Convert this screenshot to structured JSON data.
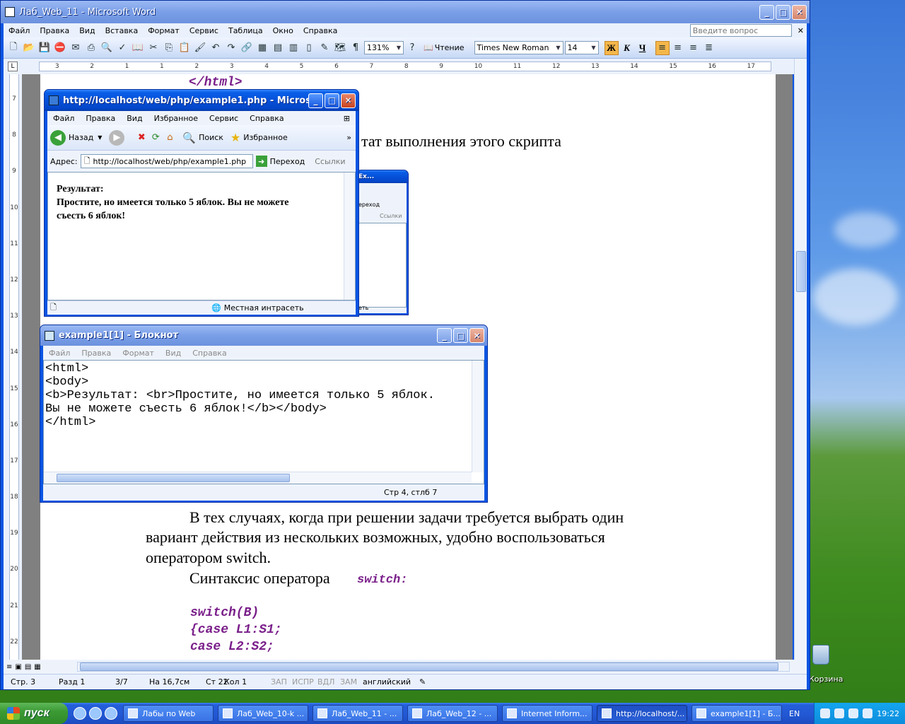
{
  "word": {
    "title": "Лаб_Web_11 - Microsoft Word",
    "menu": [
      "Файл",
      "Правка",
      "Вид",
      "Вставка",
      "Формат",
      "Сервис",
      "Таблица",
      "Окно",
      "Справка"
    ],
    "ask_placeholder": "Введите вопрос",
    "zoom": "131%",
    "reading_label": "Чтение",
    "font_name": "Times New Roman",
    "font_size": "14",
    "bold_label": "Ж",
    "italic_label": "К",
    "underline_label": "Ч",
    "ruler_numbers": [
      "3",
      "2",
      "1",
      "1",
      "2",
      "3",
      "4",
      "5",
      "6",
      "7",
      "8",
      "9",
      "10",
      "11",
      "12",
      "13",
      "14",
      "15",
      "16",
      "17"
    ],
    "vruler_numbers": [
      "7",
      "8",
      "9",
      "10",
      "11",
      "12",
      "13",
      "14",
      "15",
      "16",
      "17",
      "18",
      "19",
      "20",
      "21",
      "22"
    ],
    "document": {
      "code_top": "</html>",
      "para_result": "тат выполнения этого скрипта",
      "para_switch_1": "В тех случаях, когда при решении задачи требуется выбрать один",
      "para_switch_2": "вариант действия из нескольких возможных, удобно воспользоваться",
      "para_switch_3": "оператором switch.",
      "syntax_label": "Синтаксис оператора",
      "syntax_code": "switch:",
      "code_lines": [
        "switch(B)",
        "{case L1:S1;",
        "case L2:S2;"
      ]
    },
    "status": {
      "page": "Стр. 3",
      "section": "Разд 1",
      "pages": "3/7",
      "position": "На 16,7см",
      "line": "Ст 22",
      "column": "Кол 1",
      "rec": "ЗАП",
      "trk": "ИСПР",
      "ext": "ВДЛ",
      "ovr": "ЗАМ",
      "language": "английский"
    }
  },
  "ie": {
    "title": "http://localhost/web/php/example1.php - Microsoft I...",
    "menu": [
      "Файл",
      "Правка",
      "Вид",
      "Избранное",
      "Сервис",
      "Справка"
    ],
    "back_label": "Назад",
    "search_label": "Поиск",
    "favorites_label": "Избранное",
    "address_label": "Адрес:",
    "address_value": "http://localhost/web/php/example1.php",
    "go_label": "Переход",
    "links_label": "Ссылки",
    "content_line1": "Результат:",
    "content_line2": "Простите, но имеется только 5 яблок. Вы не можете",
    "content_line3": "съесть 6 яблок!",
    "status_zone": "Местная интрасеть"
  },
  "ie_back": {
    "title": "Ex...",
    "go_label": "ереход",
    "links_label": "Ссылки",
    "status_fragment": "еть"
  },
  "notepad": {
    "title": "example1[1] - Блокнот",
    "menu": [
      "Файл",
      "Правка",
      "Формат",
      "Вид",
      "Справка"
    ],
    "text": "<html>\n<body>\n<b>Результат: <br>Простите, но имеется только 5 яблок.\nВы не можете съесть 6 яблок!</b></body>\n</html>",
    "status": "Стр 4, стлб 7"
  },
  "desktop": {
    "recycle_label": "Корзина"
  },
  "taskbar": {
    "start_label": "пуск",
    "tasks": [
      {
        "label": "Лабы по Web",
        "active": false
      },
      {
        "label": "Лаб_Web_10-k ...",
        "active": false
      },
      {
        "label": "Лаб_Web_11 - ...",
        "active": false
      },
      {
        "label": "Лаб_Web_12 - ...",
        "active": false
      },
      {
        "label": "Internet Inform...",
        "active": false
      },
      {
        "label": "http://localhost/...",
        "active": true
      },
      {
        "label": "example1[1] - Б...",
        "active": false
      }
    ],
    "lang": "EN",
    "clock": "19:22"
  }
}
